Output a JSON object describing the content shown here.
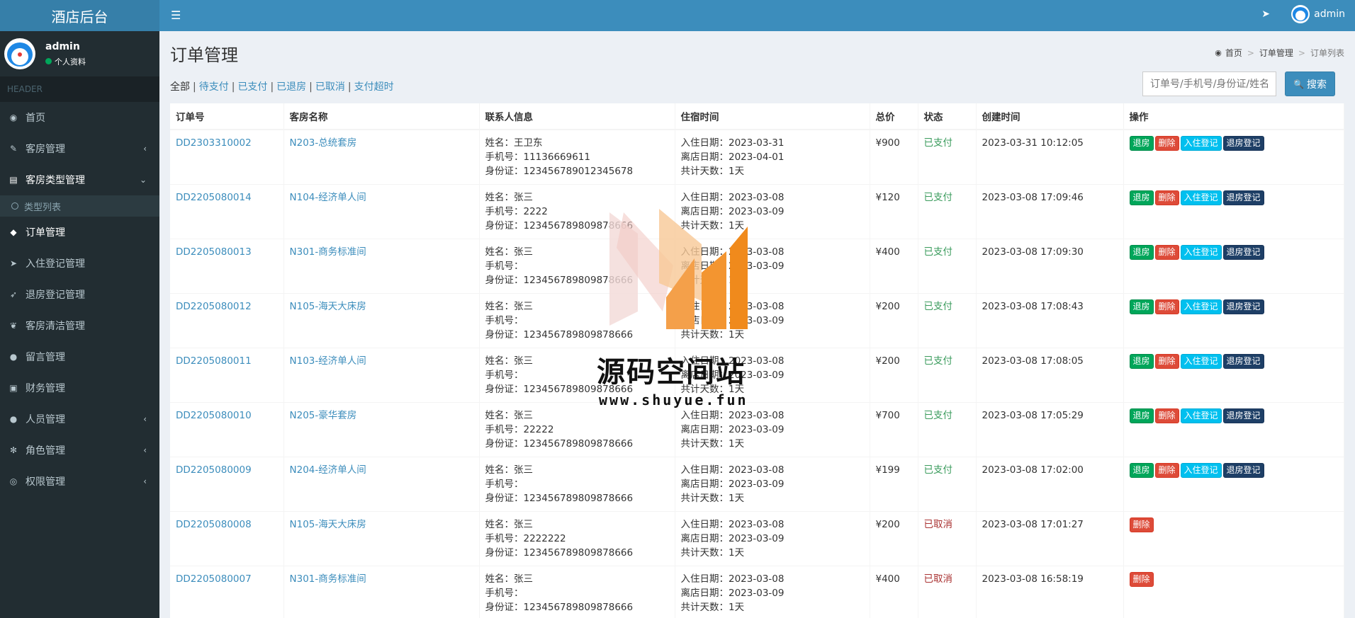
{
  "app": {
    "title": "酒店后台"
  },
  "user": {
    "name": "admin",
    "status": "个人资料",
    "top_name": "admin"
  },
  "sidebar": {
    "header": "HEADER",
    "items": [
      {
        "label": "首页",
        "icon": "dashboard-icon"
      },
      {
        "label": "客房管理",
        "icon": "brush-icon",
        "arrow": "‹"
      },
      {
        "label": "客房类型管理",
        "icon": "book-icon",
        "arrow": "⌄"
      },
      {
        "label": "类型列表",
        "sub": true
      },
      {
        "label": "订单管理",
        "icon": "tag-icon"
      },
      {
        "label": "入住登记管理",
        "icon": "location-arrow-icon"
      },
      {
        "label": "退房登记管理",
        "icon": "rocket-icon"
      },
      {
        "label": "客房清洁管理",
        "icon": "leaf-icon"
      },
      {
        "label": "留言管理",
        "icon": "comment-icon"
      },
      {
        "label": "财务管理",
        "icon": "money-icon"
      },
      {
        "label": "人员管理",
        "icon": "user-icon",
        "arrow": "‹"
      },
      {
        "label": "角色管理",
        "icon": "snowflake-icon",
        "arrow": "‹"
      },
      {
        "label": "权限管理",
        "icon": "compass-icon",
        "arrow": "‹"
      }
    ]
  },
  "page": {
    "title": "订单管理",
    "breadcrumb": [
      "首页",
      "订单管理",
      "订单列表"
    ],
    "filters": [
      "全部",
      "待支付",
      "已支付",
      "已退房",
      "已取消",
      "支付超时"
    ],
    "search_placeholder": "订单号/手机号/身份证/姓名",
    "search_label": "搜索"
  },
  "table": {
    "headers": [
      "订单号",
      "客房名称",
      "联系人信息",
      "住宿时间",
      "总价",
      "状态",
      "创建时间",
      "操作"
    ],
    "rows": [
      {
        "id": "DD2303310002",
        "room": "N203-总统套房",
        "name": "姓名：王卫东",
        "phone": "手机号：11136669611",
        "idcard": "身份证：123456789012345678",
        "in": "入住日期：2023-03-31",
        "out": "离店日期：2023-04-01",
        "days": "共计天数：1天",
        "price": "¥900",
        "status": "已支付",
        "created": "2023-03-31 10:12:05",
        "paid": true
      },
      {
        "id": "DD2205080014",
        "room": "N104-经济单人间",
        "name": "姓名：张三",
        "phone": "手机号：2222",
        "idcard": "身份证：123456789809878666",
        "in": "入住日期：2023-03-08",
        "out": "离店日期：2023-03-09",
        "days": "共计天数：1天",
        "price": "¥120",
        "status": "已支付",
        "created": "2023-03-08 17:09:46",
        "paid": true
      },
      {
        "id": "DD2205080013",
        "room": "N301-商务标准间",
        "name": "姓名：张三",
        "phone": "手机号：",
        "idcard": "身份证：123456789809878666",
        "in": "入住日期：2023-03-08",
        "out": "离店日期：2023-03-09",
        "days": "共计天数：1天",
        "price": "¥400",
        "status": "已支付",
        "created": "2023-03-08 17:09:30",
        "paid": true
      },
      {
        "id": "DD2205080012",
        "room": "N105-海天大床房",
        "name": "姓名：张三",
        "phone": "手机号：",
        "idcard": "身份证：123456789809878666",
        "in": "入住日期：2023-03-08",
        "out": "离店日期：2023-03-09",
        "days": "共计天数：1天",
        "price": "¥200",
        "status": "已支付",
        "created": "2023-03-08 17:08:43",
        "paid": true
      },
      {
        "id": "DD2205080011",
        "room": "N103-经济单人间",
        "name": "姓名：张三",
        "phone": "手机号：",
        "idcard": "身份证：123456789809878666",
        "in": "入住日期：2023-03-08",
        "out": "离店日期：2023-03-09",
        "days": "共计天数：1天",
        "price": "¥200",
        "status": "已支付",
        "created": "2023-03-08 17:08:05",
        "paid": true
      },
      {
        "id": "DD2205080010",
        "room": "N205-豪华套房",
        "name": "姓名：张三",
        "phone": "手机号：22222",
        "idcard": "身份证：123456789809878666",
        "in": "入住日期：2023-03-08",
        "out": "离店日期：2023-03-09",
        "days": "共计天数：1天",
        "price": "¥700",
        "status": "已支付",
        "created": "2023-03-08 17:05:29",
        "paid": true
      },
      {
        "id": "DD2205080009",
        "room": "N204-经济单人间",
        "name": "姓名：张三",
        "phone": "手机号：",
        "idcard": "身份证：123456789809878666",
        "in": "入住日期：2023-03-08",
        "out": "离店日期：2023-03-09",
        "days": "共计天数：1天",
        "price": "¥199",
        "status": "已支付",
        "created": "2023-03-08 17:02:00",
        "paid": true
      },
      {
        "id": "DD2205080008",
        "room": "N105-海天大床房",
        "name": "姓名：张三",
        "phone": "手机号：2222222",
        "idcard": "身份证：123456789809878666",
        "in": "入住日期：2023-03-08",
        "out": "离店日期：2023-03-09",
        "days": "共计天数：1天",
        "price": "¥200",
        "status": "已取消",
        "created": "2023-03-08 17:01:27",
        "paid": false
      },
      {
        "id": "DD2205080007",
        "room": "N301-商务标准间",
        "name": "姓名：张三",
        "phone": "手机号：",
        "idcard": "身份证：123456789809878666",
        "in": "入住日期：2023-03-08",
        "out": "离店日期：2023-03-09",
        "days": "共计天数：1天",
        "price": "¥400",
        "status": "已取消",
        "created": "2023-03-08 16:58:19",
        "paid": false
      }
    ],
    "actions": {
      "checkout": "退房",
      "delete": "删除",
      "checkin": "入住登记",
      "checkout_reg": "退房登记"
    }
  },
  "watermark": {
    "text": "源码空间站",
    "url": "www.shuyue.fun"
  },
  "colors": {
    "topbar": "#3c8dbc",
    "sidebar": "#222d32",
    "link": "#3c8dbc",
    "paid": "#3a9b5c",
    "cancel": "#aa3333"
  }
}
